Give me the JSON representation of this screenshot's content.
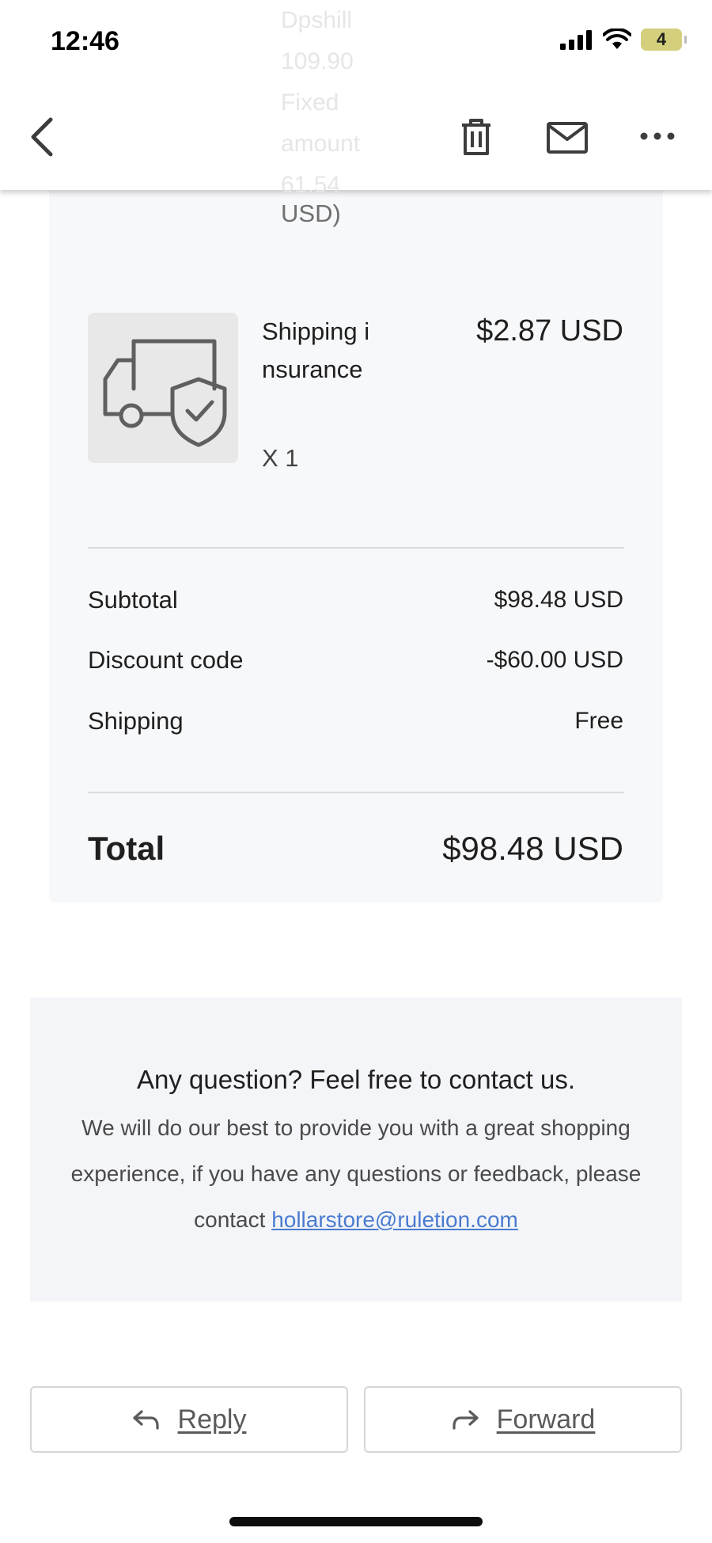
{
  "status_bar": {
    "time": "12:46",
    "battery": "4"
  },
  "header_ghost_text": "Dpshill\n109.90\nFixed\namount\n61.54",
  "top_nav": {
    "back_icon": "chevron-left-icon",
    "delete_icon": "trash-icon",
    "mark_icon": "mail-icon",
    "more_icon": "more-horizontal-icon"
  },
  "order": {
    "previous_item_tail": "USD)",
    "item": {
      "name": "Shipping insurance",
      "quantity": "X 1",
      "price": "$2.87 USD",
      "icon": "truck-shield-icon"
    },
    "summary": [
      {
        "label": "Subtotal",
        "value": "$98.48 USD"
      },
      {
        "label": "Discount code",
        "value": "-$60.00 USD"
      },
      {
        "label": "Shipping",
        "value": "Free"
      }
    ],
    "total_label": "Total",
    "total_value": "$98.48 USD"
  },
  "contact": {
    "title": "Any question? Feel free to contact us.",
    "body": "We will do our best to provide you with a great shopping experience, if you have any questions or feedback, please contact ",
    "email": "hollarstore@ruletion.com"
  },
  "actions": {
    "reply_label": "Reply",
    "forward_label": "Forward"
  }
}
